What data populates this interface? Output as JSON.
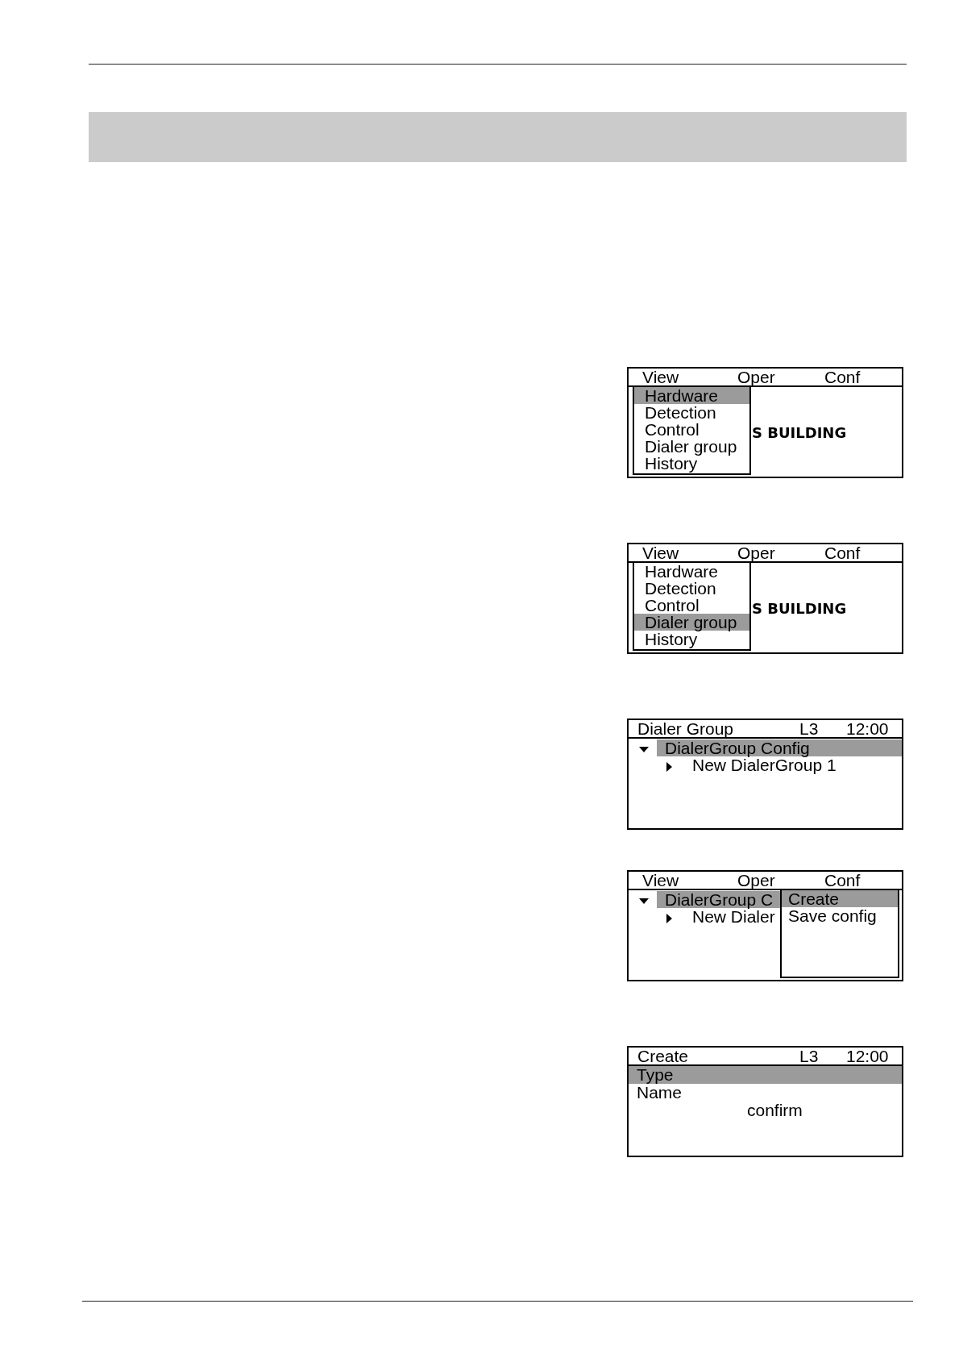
{
  "screens": [
    {
      "kind": "menu",
      "menubar": [
        "View",
        "Oper",
        "Conf"
      ],
      "background_text": "S BUILDING",
      "menu": {
        "items": [
          {
            "label": "Hardware",
            "selected": true
          },
          {
            "label": "Detection",
            "selected": false
          },
          {
            "label": "Control",
            "selected": false
          },
          {
            "label": "Dialer group",
            "selected": false
          },
          {
            "label": "History",
            "selected": false
          }
        ]
      }
    },
    {
      "kind": "menu",
      "menubar": [
        "View",
        "Oper",
        "Conf"
      ],
      "background_text": "S BUILDING",
      "menu": {
        "items": [
          {
            "label": "Hardware",
            "selected": false
          },
          {
            "label": "Detection",
            "selected": false
          },
          {
            "label": "Control",
            "selected": false
          },
          {
            "label": "Dialer group",
            "selected": true
          },
          {
            "label": "History",
            "selected": false
          }
        ]
      }
    },
    {
      "kind": "tree",
      "title": "Dialer Group",
      "access_level": "L3",
      "time": "12:00",
      "tree": [
        {
          "label": "DialerGroup Config",
          "expanded": true,
          "selected": true,
          "children": [
            {
              "label": "New DialerGroup 1",
              "expanded": false,
              "selected": false
            }
          ]
        }
      ]
    },
    {
      "kind": "tree_menu",
      "menubar": [
        "View",
        "Oper",
        "Conf"
      ],
      "tree": [
        {
          "label": "DialerGroup C",
          "expanded": true,
          "selected": true,
          "children": [
            {
              "label": "New Dialer",
              "expanded": false,
              "selected": false
            }
          ]
        }
      ],
      "popup": {
        "items": [
          {
            "label": "Create",
            "selected": true
          },
          {
            "label": "Save config",
            "selected": false
          }
        ]
      }
    },
    {
      "kind": "form",
      "title": "Create",
      "access_level": "L3",
      "time": "12:00",
      "fields": [
        {
          "label": "Type",
          "selected": true
        },
        {
          "label": "Name",
          "selected": false
        }
      ],
      "action": "confirm"
    }
  ]
}
